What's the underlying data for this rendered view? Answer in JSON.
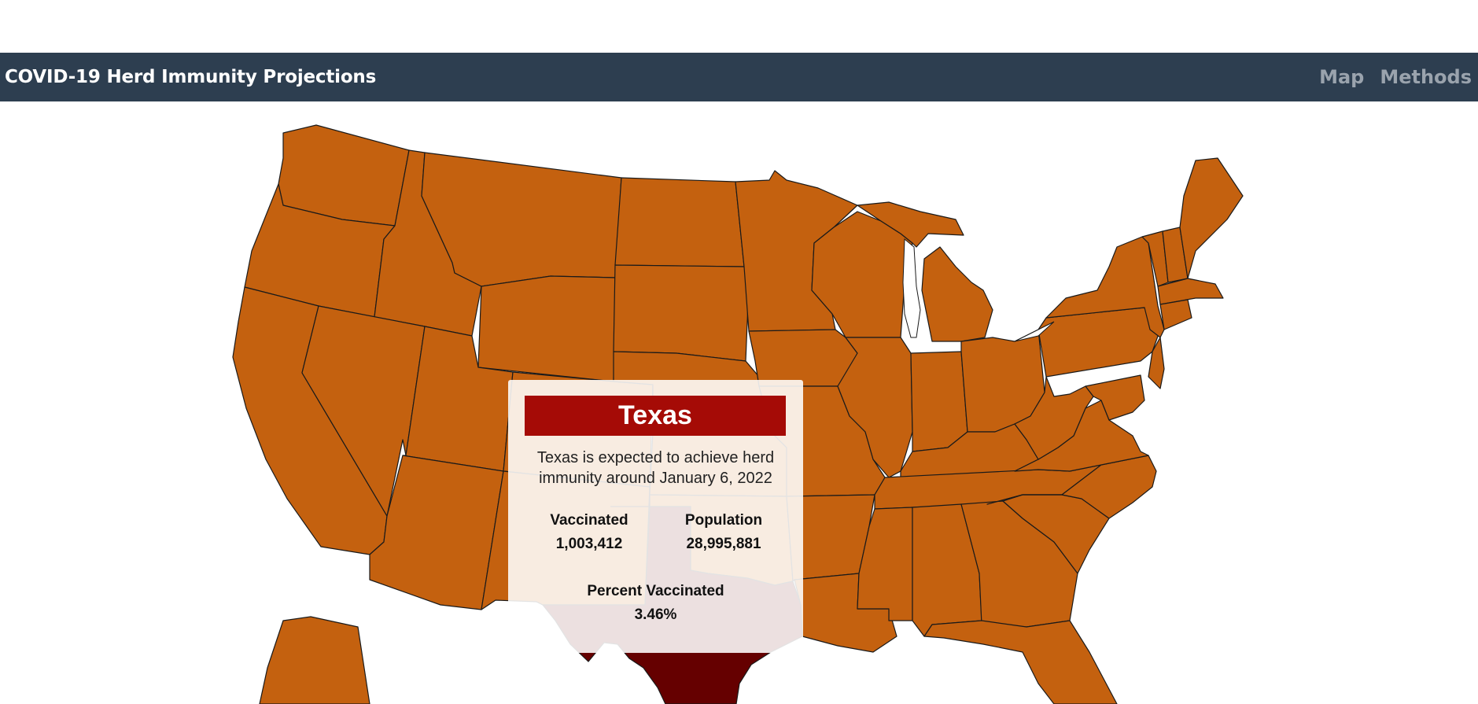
{
  "navbar": {
    "brand": "COVID-19 Herd Immunity Projections",
    "links": [
      "Map",
      "Methods"
    ]
  },
  "map": {
    "default_fill": "#c4610f",
    "highlight_fill": "#650000",
    "stroke": "#1a1a1a",
    "highlighted_state": "Texas"
  },
  "tooltip": {
    "title": "Texas",
    "desc_line1": "Texas is expected to achieve herd",
    "desc_line2": "immunity around January 6, 2022",
    "vaccinated_label": "Vaccinated",
    "vaccinated_value": "1,003,412",
    "population_label": "Population",
    "population_value": "28,995,881",
    "percent_label": "Percent Vaccinated",
    "percent_value": "3.46%",
    "title_bg": "#a50b06"
  }
}
